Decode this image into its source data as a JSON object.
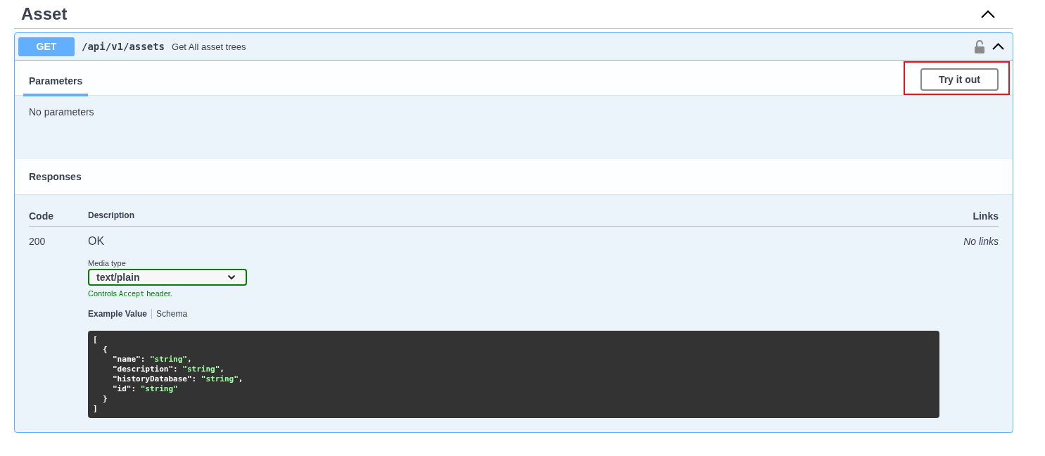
{
  "section": {
    "title": "Asset",
    "expanded": true
  },
  "operation": {
    "method": "GET",
    "path": "/api/v1/assets",
    "summary": "Get All asset trees",
    "locked": false,
    "expanded": true,
    "tabs": [
      {
        "label": "Parameters",
        "selected": true
      }
    ],
    "try_button": {
      "label": "Try it out",
      "highlighted": true
    },
    "no_parameters": "No parameters",
    "responses_title": "Responses",
    "columns": [
      "Code",
      "Description",
      "Links"
    ],
    "responses": [
      {
        "code": "200",
        "description": "OK",
        "media_label": "Media type",
        "media_value": "text/plain",
        "hint": {
          "before": "Controls ",
          "code": "Accept",
          "after": " header."
        },
        "model_tabs": [
          {
            "label": "Example Value",
            "selected": true
          },
          {
            "label": "Schema",
            "selected": false
          }
        ],
        "example": {
          "open": "[",
          "items": [
            {
              "open": "{",
              "fields": [
                {
                  "key": "\"name\"",
                  "colon": ":",
                  "value": "\"string\"",
                  "comma": ","
                },
                {
                  "key": "\"description\"",
                  "colon": ":",
                  "value": "\"string\"",
                  "comma": ","
                },
                {
                  "key": "\"historyDatabase\"",
                  "colon": ":",
                  "value": "\"string\"",
                  "comma": ","
                },
                {
                  "key": "\"id\"",
                  "colon": ":",
                  "value": "\"string\""
                }
              ],
              "close": "}"
            }
          ],
          "close": "]"
        },
        "links": "No links"
      }
    ]
  }
}
